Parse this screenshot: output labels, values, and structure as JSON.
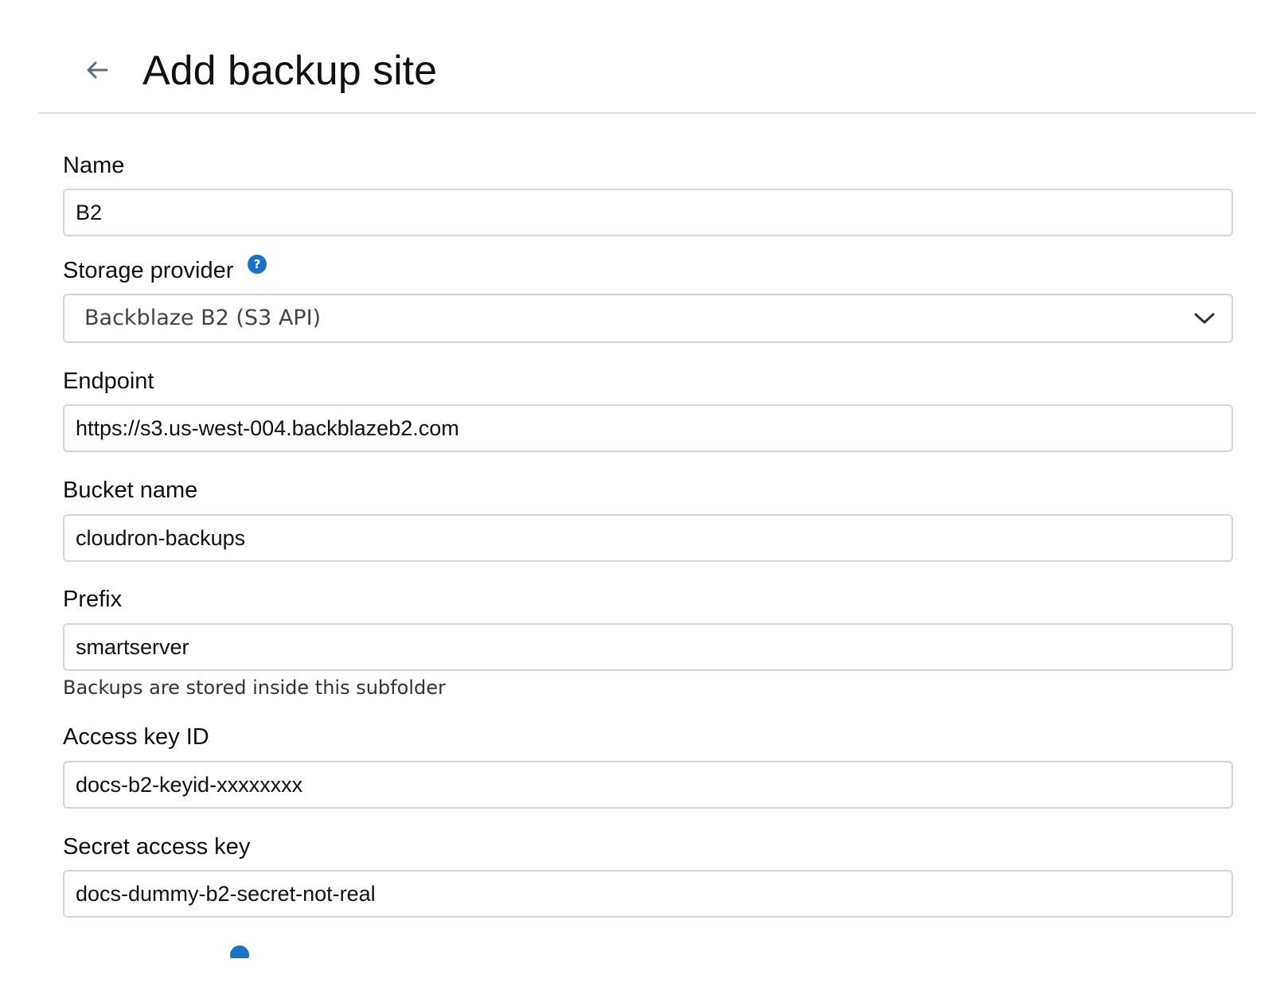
{
  "header": {
    "title": "Add backup site",
    "back_icon": "arrow-left-icon"
  },
  "form": {
    "name": {
      "label": "Name",
      "value": "B2"
    },
    "storage_provider": {
      "label": "Storage provider",
      "help_icon": "question-circle-icon",
      "help_glyph": "?",
      "selected": "Backblaze B2 (S3 API)",
      "dropdown_icon": "chevron-down-icon"
    },
    "endpoint": {
      "label": "Endpoint",
      "value": "https://s3.us-west-004.backblazeb2.com"
    },
    "bucket_name": {
      "label": "Bucket name",
      "value": "cloudron-backups"
    },
    "prefix": {
      "label": "Prefix",
      "value": "smartserver",
      "hint": "Backups are stored inside this subfolder"
    },
    "access_key_id": {
      "label": "Access key ID",
      "value": "docs-b2-keyid-xxxxxxxx"
    },
    "secret_access_key": {
      "label": "Secret access key",
      "value": "docs-dummy-b2-secret-not-real"
    }
  },
  "colors": {
    "accent": "#1a73c7",
    "border": "#d3d7dc",
    "divider": "#dcdfe3",
    "text": "#111111"
  }
}
